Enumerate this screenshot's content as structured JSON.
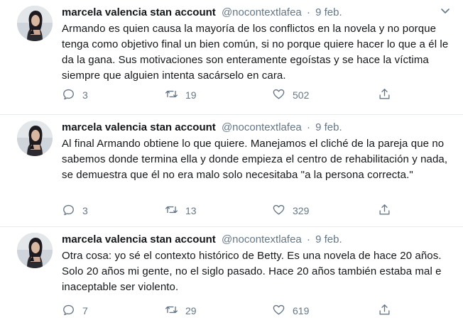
{
  "tweets": [
    {
      "author_name": "marcela valencia stan account",
      "author_handle": "@nocontextlafea",
      "separator": "·",
      "date": "9 feb.",
      "text": "Armando es quien causa la mayoría de los conflictos en la novela y no porque tenga como objetivo final un bien común, si no porque quiere hacer lo que a él le da la gana. Sus motivaciones son enteramente egoístas y se hace la víctima siempre que alguien intenta sacárselo en cara.",
      "replies": "3",
      "retweets": "19",
      "likes": "502"
    },
    {
      "author_name": "marcela valencia stan account",
      "author_handle": "@nocontextlafea",
      "separator": "·",
      "date": "9 feb.",
      "text": "Al final Armando obtiene lo que quiere. Manejamos el cliché de la pareja que no sabemos donde termina ella y donde empieza el centro de rehabilitación y nada, se demuestra que él no era malo solo necesitaba \"a la persona correcta.\"",
      "replies": "3",
      "retweets": "13",
      "likes": "329"
    },
    {
      "author_name": "marcela valencia stan account",
      "author_handle": "@nocontextlafea",
      "separator": "·",
      "date": "9 feb.",
      "text": "Otra cosa: yo sé el contexto histórico de Betty. Es una novela de hace 20 años. Solo 20 años mi gente, no el siglo pasado. Hace 20 años también estaba mal e inaceptable ser violento.",
      "replies": "7",
      "retweets": "29",
      "likes": "619"
    }
  ],
  "icons": {
    "reply": "reply-icon",
    "retweet": "retweet-icon",
    "like": "like-icon",
    "share": "share-icon",
    "caret": "chevron-down-icon",
    "avatar": "avatar"
  },
  "colors": {
    "text": "#14171a",
    "secondary": "#657786",
    "divider": "#e6ecf0",
    "background": "#ffffff"
  }
}
